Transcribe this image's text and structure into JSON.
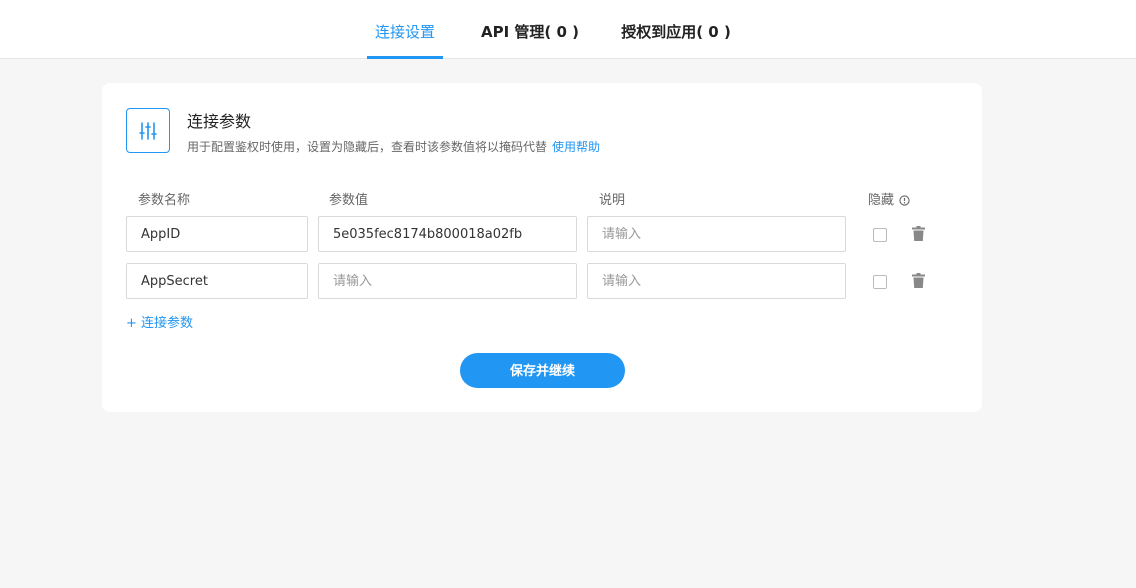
{
  "tabs": [
    {
      "label": "连接设置",
      "active": true
    },
    {
      "label": "API 管理( 0 )",
      "active": false
    },
    {
      "label": "授权到应用( 0 )",
      "active": false
    }
  ],
  "section": {
    "icon": "sliders-icon",
    "title": "连接参数",
    "description": "用于配置鉴权时使用，设置为隐藏后，查看时该参数值将以掩码代替",
    "help_link": "使用帮助"
  },
  "columns": {
    "name": "参数名称",
    "value": "参数值",
    "note": "说明",
    "hidden": "隐藏"
  },
  "rows": [
    {
      "name": "AppID",
      "value": "5e035fec8174b800018a02fb",
      "value_placeholder": "请输入",
      "note": "",
      "note_placeholder": "请输入",
      "hidden": false
    },
    {
      "name": "AppSecret",
      "value": "",
      "value_placeholder": "请输入",
      "note": "",
      "note_placeholder": "请输入",
      "hidden": false
    }
  ],
  "add_label": "+ 连接参数",
  "save_label": "保存并继续",
  "colors": {
    "accent": "#2196f3",
    "background": "#f5f6f5"
  }
}
